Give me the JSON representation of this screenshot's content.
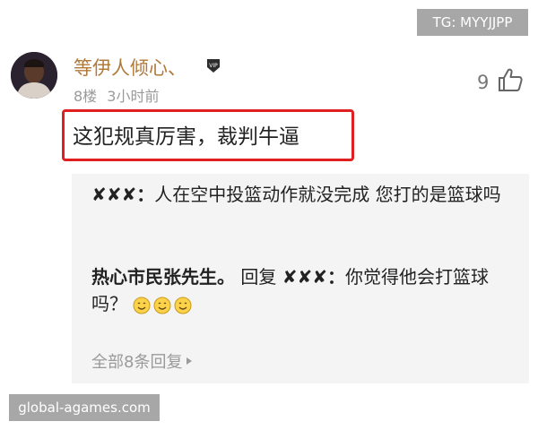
{
  "watermark_top": "TG: MYYJJPP",
  "watermark_bottom": "global-agames.com",
  "comment": {
    "username": "等伊人倾心、",
    "badge": "VIP",
    "floor": "8楼",
    "time": "3小时前",
    "likes": "9",
    "text": "这犯规真厉害，裁判牛逼"
  },
  "replies": [
    {
      "author": "✘✘✘",
      "separator": "：",
      "text": "人在空中投篮动作就没完成 您打的是篮球吗"
    },
    {
      "author": "热心市民张先生。",
      "reply_word": "回复",
      "target": "✘✘✘",
      "separator": "：",
      "text": "你觉得他会打篮球吗？"
    }
  ],
  "more_replies": "全部8条回复",
  "icons": {
    "like": "thumbs-up-icon",
    "badge": "vip-badge-icon",
    "emoji": "smiley-emoji-icon",
    "arrow": "triangle-right-icon"
  },
  "colors": {
    "username": "#b07a3a",
    "highlight": "#e02020",
    "reply_bg": "#f4f4f4"
  }
}
